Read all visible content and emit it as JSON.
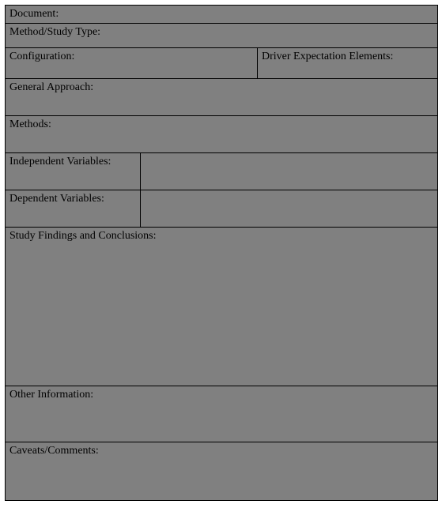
{
  "labels": {
    "document": "Document:",
    "method_study_type": "Method/Study Type:",
    "configuration": "Configuration:",
    "driver_expectation": "Driver Expectation Elements:",
    "general_approach": "General Approach:",
    "methods": "Methods:",
    "independent_vars": "Independent Variables:",
    "dependent_vars": "Dependent Variables:",
    "findings": "Study Findings and Conclusions:",
    "other_info": "Other Information:",
    "caveats": "Caveats/Comments:"
  },
  "values": {
    "document": "",
    "method_study_type": "",
    "configuration": "",
    "driver_expectation": "",
    "general_approach": "",
    "methods": "",
    "independent_vars": "",
    "dependent_vars": "",
    "findings": "",
    "other_info": "",
    "caveats": ""
  }
}
